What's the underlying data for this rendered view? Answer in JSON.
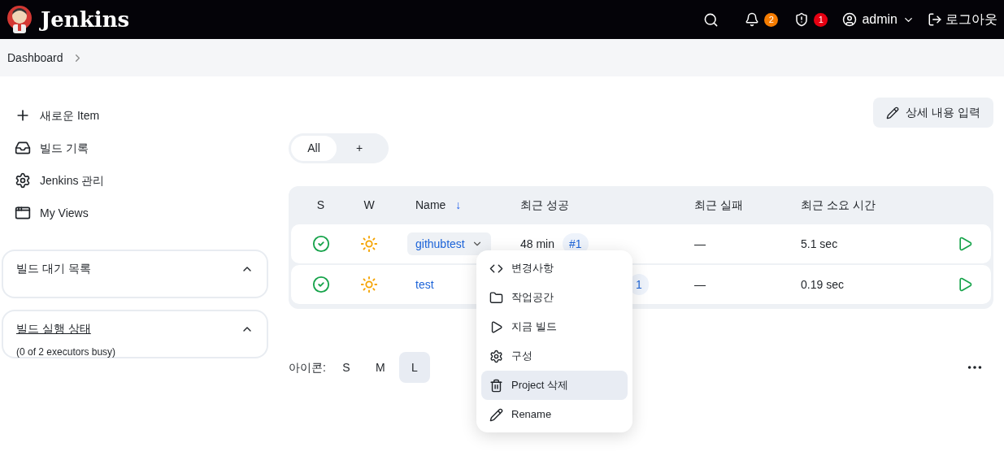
{
  "header": {
    "brand": "Jenkins",
    "notifications": {
      "count": "2"
    },
    "security": {
      "count": "1"
    },
    "user": "admin",
    "logout": "로그아웃"
  },
  "breadcrumb": [
    "Dashboard"
  ],
  "sidebar": {
    "items": [
      {
        "kind": "plus",
        "label": "새로운 Item"
      },
      {
        "kind": "inbox",
        "label": "빌드 기록"
      },
      {
        "kind": "gear",
        "label": "Jenkins 관리"
      },
      {
        "kind": "window",
        "label": "My Views"
      }
    ],
    "panels": [
      {
        "title": "빌드 대기 목록",
        "link": false,
        "expanded": true
      },
      {
        "title": "빌드 실행 상태",
        "link": true,
        "expanded": true,
        "body": "(0 of 2 executors busy)"
      }
    ]
  },
  "edit_description": "상세 내용 입력",
  "tabs": [
    {
      "label": "All",
      "selected": true
    },
    {
      "label": "+",
      "selected": false
    }
  ],
  "table": {
    "columns": [
      "S",
      "W",
      "Name",
      "최근 성공",
      "최근 실패",
      "최근 소요 시간"
    ],
    "sort_arrow": "↓",
    "rows": [
      {
        "passed": true,
        "sunny": true,
        "name": "githubtest",
        "menu_open": true,
        "last_success": "48 min",
        "build": "#1",
        "last_failure": "—",
        "duration": "5.1 sec"
      },
      {
        "passed": true,
        "sunny": true,
        "name": "test",
        "menu_open": false,
        "build": "1",
        "last_failure": "—",
        "duration": "0.19 sec"
      }
    ]
  },
  "icon_size": {
    "label": "아이콘:",
    "options": [
      {
        "label": "S",
        "selected": false
      },
      {
        "label": "M",
        "selected": false
      },
      {
        "label": "L",
        "selected": true
      }
    ]
  },
  "context_menu": [
    {
      "kind": "code",
      "label": "변경사항",
      "selected": false
    },
    {
      "kind": "folder",
      "label": "작업공간",
      "selected": false
    },
    {
      "kind": "play",
      "label": "지금 빌드",
      "selected": false
    },
    {
      "kind": "gear",
      "label": "구성",
      "selected": false
    },
    {
      "kind": "trash",
      "label": "Project 삭제",
      "selected": true
    },
    {
      "kind": "pencil",
      "label": "Rename",
      "selected": false
    }
  ]
}
